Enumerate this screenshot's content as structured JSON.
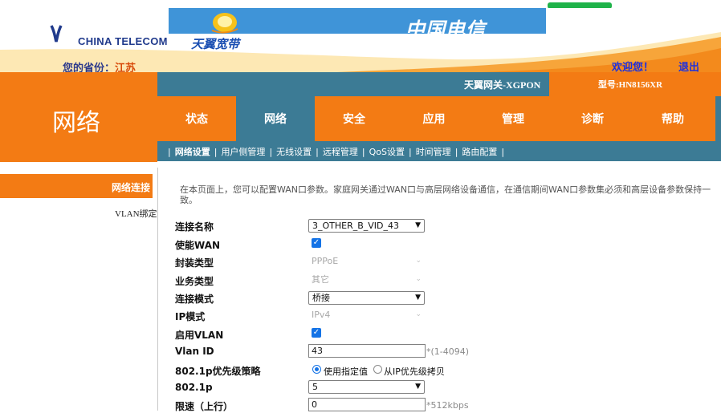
{
  "header": {
    "company_en": "CHINA TELECOM",
    "product_brand": "天翼宽带",
    "banner_brand_cn": "中国电信",
    "province_label": "您的省份：",
    "province_value": "江苏",
    "welcome": "欢迎您！",
    "logout": "退出",
    "gateway_name": "天翼网关-XGPON",
    "model": "型号:HN8156XR"
  },
  "section_title": "网络",
  "tabs": [
    {
      "label": "状态",
      "active": false
    },
    {
      "label": "网络",
      "active": true
    },
    {
      "label": "安全",
      "active": false
    },
    {
      "label": "应用",
      "active": false
    },
    {
      "label": "管理",
      "active": false
    },
    {
      "label": "诊断",
      "active": false
    },
    {
      "label": "帮助",
      "active": false
    }
  ],
  "subnav": [
    {
      "label": "网络设置",
      "active": true
    },
    {
      "label": "用户侧管理",
      "active": false
    },
    {
      "label": "无线设置",
      "active": false
    },
    {
      "label": "远程管理",
      "active": false
    },
    {
      "label": "QoS设置",
      "active": false
    },
    {
      "label": "时间管理",
      "active": false
    },
    {
      "label": "路由配置",
      "active": false
    }
  ],
  "sidebar": [
    {
      "label": "网络连接",
      "active": true
    },
    {
      "label": "VLAN绑定",
      "active": false
    }
  ],
  "description": "在本页面上，您可以配置WAN口参数。家庭网关通过WAN口与高层网络设备通信，在通信期间WAN口参数集必须和高层设备参数保持一致。",
  "form": {
    "connection_name": {
      "label": "连接名称",
      "value": "3_OTHER_B_VID_43"
    },
    "enable_wan": {
      "label": "使能WAN",
      "checked": true
    },
    "encap_type": {
      "label": "封装类型",
      "value": "PPPoE"
    },
    "service_type": {
      "label": "业务类型",
      "value": "其它"
    },
    "conn_mode": {
      "label": "连接模式",
      "value": "桥接"
    },
    "ip_mode": {
      "label": "IP模式",
      "value": "IPv4"
    },
    "enable_vlan": {
      "label": "启用VLAN",
      "checked": true
    },
    "vlan_id": {
      "label": "Vlan ID",
      "value": "43",
      "hint": "*(1-4094)"
    },
    "priority_policy": {
      "label": "802.1p优先级策略",
      "option1": "使用指定值",
      "option2": "从IP优先级拷贝",
      "selected": "option1"
    },
    "p8021": {
      "label": "802.1p",
      "value": "5"
    },
    "rate_up": {
      "label": "限速（上行）",
      "value": "0",
      "hint": "*512kbps"
    }
  },
  "colors": {
    "orange": "#f37b14",
    "teal": "#3c7b95",
    "check_blue": "#1473e6"
  }
}
